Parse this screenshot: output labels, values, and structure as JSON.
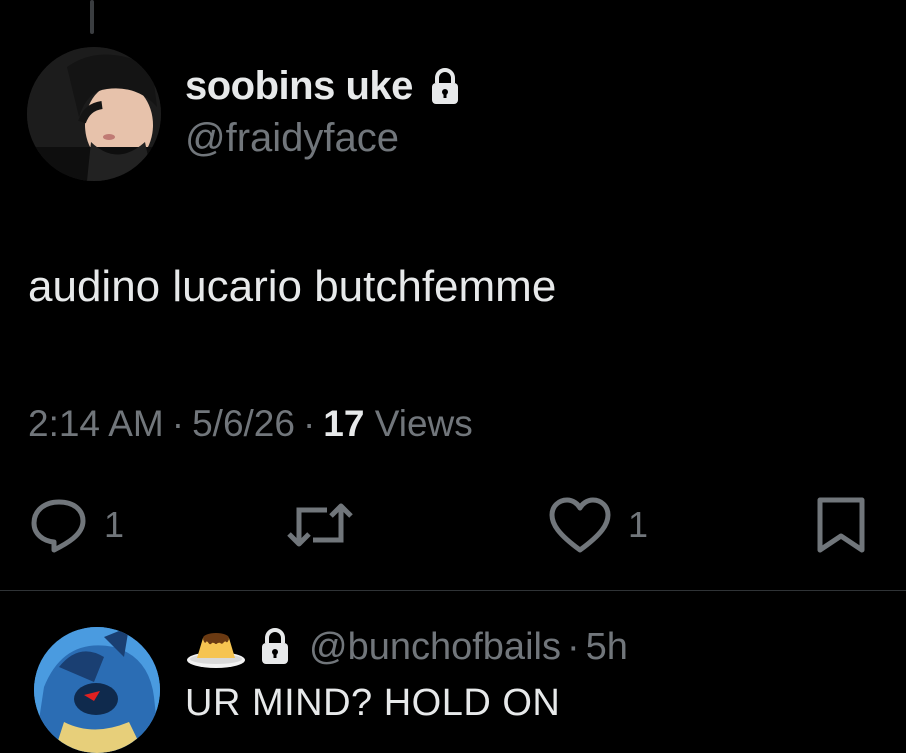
{
  "tweet": {
    "display_name": "soobins uke",
    "handle": "@fraidyface",
    "text": "audino lucario butchfemme",
    "time": "2:14 AM",
    "date": "5/6/26",
    "views_count": "17",
    "views_label": "Views",
    "separator": "·",
    "protected_icon": "lock-icon"
  },
  "actions": {
    "reply_count": "1",
    "repost_count": "",
    "like_count": "1",
    "icons": [
      "reply-icon",
      "repost-icon",
      "like-icon",
      "bookmark-icon"
    ]
  },
  "reply": {
    "emoji": "custard-pudding-emoji",
    "handle": "@bunchofbails",
    "separator": "·",
    "age": "5h",
    "text": "UR MIND? HOLD ON"
  },
  "colors": {
    "background": "#000000",
    "primary_text": "#e7e9ea",
    "secondary_text": "#71767b",
    "divider": "#2f3336"
  }
}
